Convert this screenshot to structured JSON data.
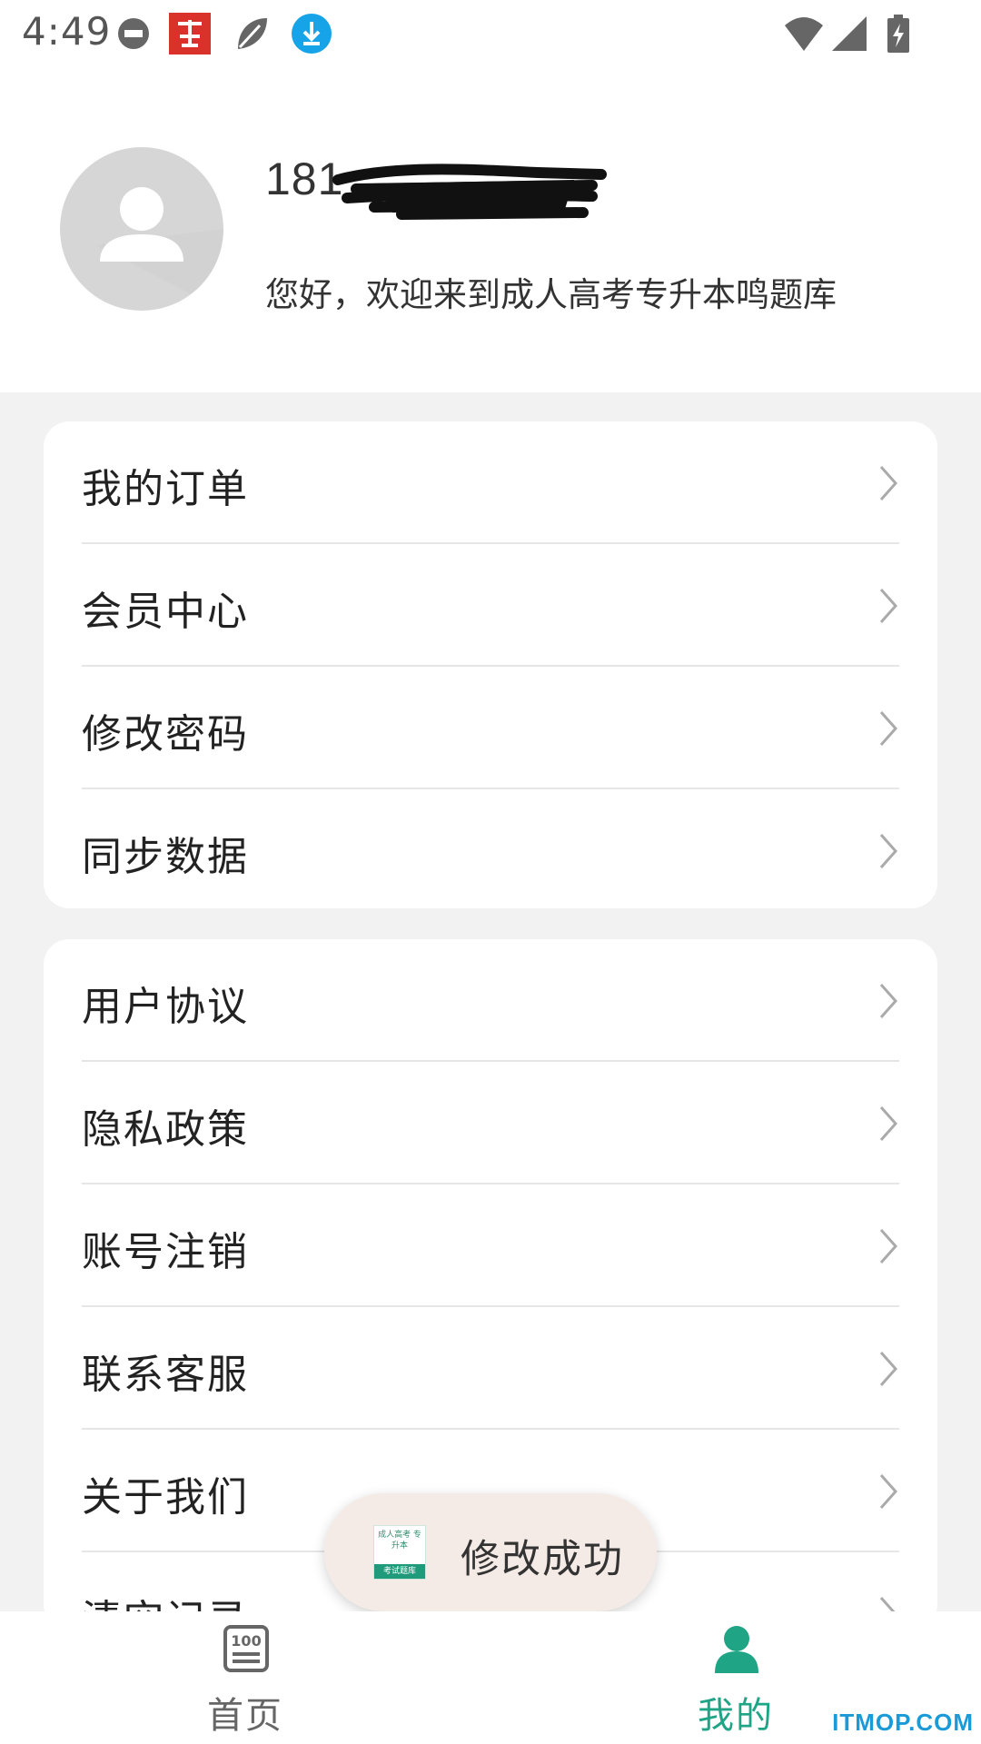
{
  "status_bar": {
    "time": "4:49",
    "notification_icons": [
      "minus-circle-icon",
      "app-logo-icon",
      "leaf-icon",
      "download-icon"
    ],
    "system_icons": [
      "wifi-icon",
      "signal-icon",
      "battery-charging-icon"
    ]
  },
  "profile": {
    "username_partial": "181",
    "username_redacted": true,
    "welcome": "您好，欢迎来到成人高考专升本鸣题库"
  },
  "menu_group_1": [
    {
      "label": "我的订单"
    },
    {
      "label": "会员中心"
    },
    {
      "label": "修改密码"
    },
    {
      "label": "同步数据"
    }
  ],
  "menu_group_2": [
    {
      "label": "用户协议"
    },
    {
      "label": "隐私政策"
    },
    {
      "label": "账号注销"
    },
    {
      "label": "联系客服"
    },
    {
      "label": "关于我们"
    },
    {
      "label": "清空记录"
    }
  ],
  "toast": {
    "logo_text": "成人高考 专升本",
    "logo_band": "考试题库",
    "message": "修改成功"
  },
  "bottom_nav": {
    "home_label": "首页",
    "mine_label": "我的",
    "active": "我的",
    "home_icon_text": "100"
  },
  "watermark": "ITMOP.COM",
  "colors": {
    "accent": "#1fa585",
    "inactive": "#666666",
    "background": "#f2f2f2"
  }
}
